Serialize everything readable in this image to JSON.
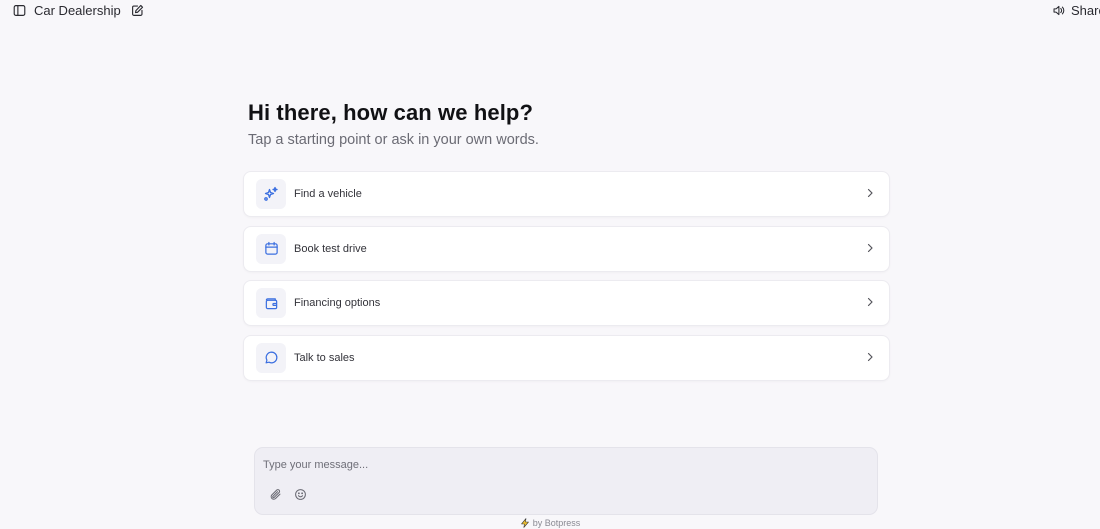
{
  "header": {
    "title": "Car Dealership",
    "share_label": "Share"
  },
  "hero": {
    "heading": "Hi there, how can we help?",
    "subheading": "Tap a starting point or ask in your own words."
  },
  "options": [
    {
      "label": "Find a vehicle",
      "icon": "sparkles-icon"
    },
    {
      "label": "Book test drive",
      "icon": "calendar-icon"
    },
    {
      "label": "Financing options",
      "icon": "wallet-icon"
    },
    {
      "label": "Talk to sales",
      "icon": "chat-bubble-icon"
    }
  ],
  "composer": {
    "placeholder": "Type your message...",
    "tools": [
      "paperclip-icon",
      "emoji-icon"
    ]
  },
  "footer": {
    "powered_by": "by Botpress",
    "icon": "lightning-icon"
  },
  "colors": {
    "accent": "#3b6fe0",
    "background": "#f8f7fa",
    "card": "#ffffff",
    "composer": "#efeef4"
  }
}
